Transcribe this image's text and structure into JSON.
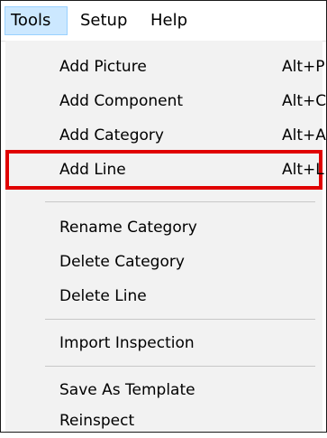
{
  "menubar": {
    "items": [
      {
        "label": "Tools",
        "open": true
      },
      {
        "label": "Setup",
        "open": false
      },
      {
        "label": "Help",
        "open": false
      }
    ]
  },
  "dropdown": {
    "items": [
      {
        "label": "Add Picture",
        "shortcut": "Alt+P"
      },
      {
        "label": "Add Component",
        "shortcut": "Alt+C"
      },
      {
        "label": "Add Category",
        "shortcut": "Alt+A"
      },
      {
        "label": "Add Line",
        "shortcut": "Alt+L",
        "highlighted": true
      },
      {
        "label": "Rename Category",
        "shortcut": ""
      },
      {
        "label": "Delete Category",
        "shortcut": ""
      },
      {
        "label": "Delete Line",
        "shortcut": ""
      },
      {
        "label": "Import Inspection",
        "shortcut": ""
      },
      {
        "label": "Save As Template",
        "shortcut": ""
      },
      {
        "label": "Reinspect",
        "shortcut": ""
      }
    ]
  },
  "colors": {
    "open_menu_bg": "#cce8ff",
    "dropdown_bg": "#f2f2f2",
    "highlight_border": "#e00000"
  }
}
